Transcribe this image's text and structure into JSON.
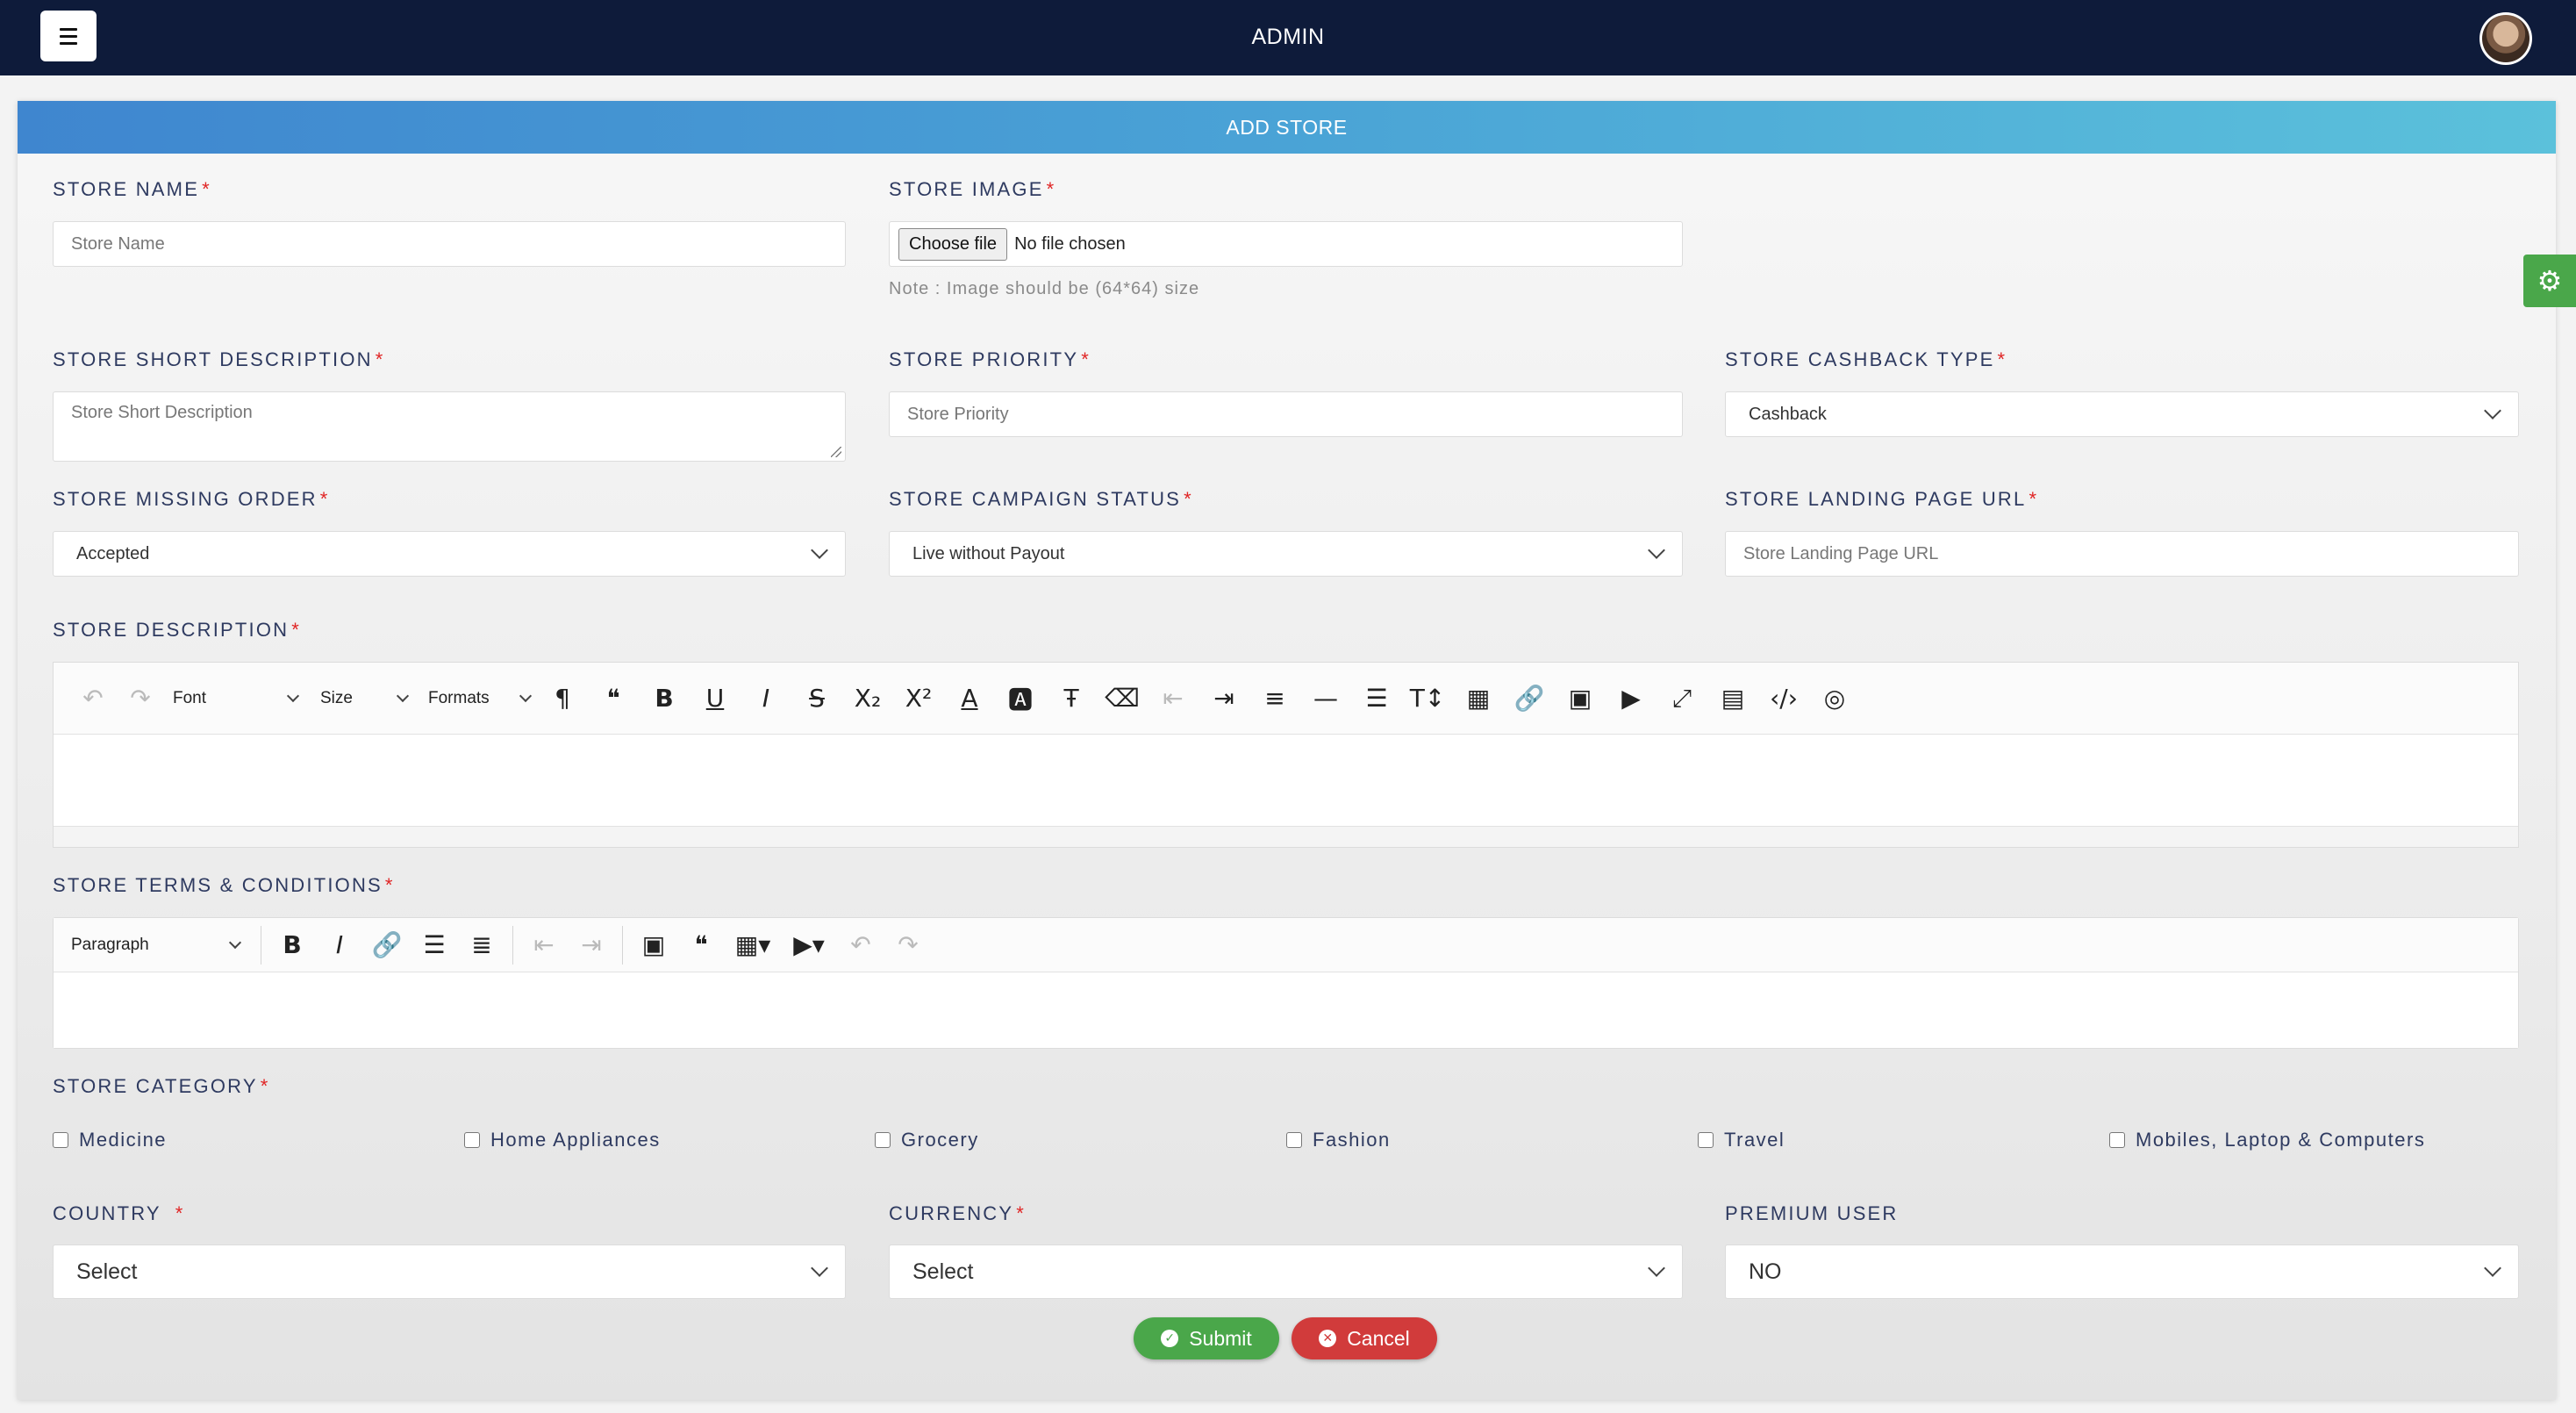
{
  "navbar": {
    "title": "ADMIN"
  },
  "card": {
    "title": "ADD STORE"
  },
  "fields": {
    "store_name": {
      "label": "STORE NAME",
      "placeholder": "Store Name"
    },
    "store_image": {
      "label": "STORE IMAGE",
      "button": "Choose file",
      "status": "No file chosen",
      "note": "Note : Image should be (64*64) size"
    },
    "short_desc": {
      "label": "STORE SHORT DESCRIPTION",
      "placeholder": "Store Short Description"
    },
    "priority": {
      "label": "STORE PRIORITY",
      "placeholder": "Store Priority"
    },
    "cashback_type": {
      "label": "STORE CASHBACK TYPE",
      "value": "Cashback"
    },
    "missing_order": {
      "label": "STORE MISSING ORDER",
      "value": "Accepted"
    },
    "campaign_status": {
      "label": "STORE CAMPAIGN STATUS",
      "value": "Live without Payout"
    },
    "landing_url": {
      "label": "STORE LANDING PAGE URL",
      "placeholder": "Store Landing Page URL"
    },
    "description": {
      "label": "STORE DESCRIPTION",
      "font": "Font",
      "size": "Size",
      "formats": "Formats"
    },
    "terms": {
      "label": "STORE TERMS & CONDITIONS",
      "block": "Paragraph"
    },
    "category": {
      "label": "STORE CATEGORY",
      "options": [
        "Medicine",
        "Home Appliances",
        "Grocery",
        "Fashion",
        "Travel",
        "Mobiles, Laptop & Computers"
      ]
    },
    "country": {
      "label": "COUNTRY",
      "value": "Select"
    },
    "currency": {
      "label": "CURRENCY",
      "value": "Select"
    },
    "premium": {
      "label": "PREMIUM USER",
      "value": "NO"
    }
  },
  "required_mark": "*",
  "actions": {
    "submit": "Submit",
    "cancel": "Cancel"
  },
  "colors": {
    "navbar": "#0e1b3a",
    "header_start": "#3f86cf",
    "header_end": "#5bc1db",
    "submit": "#4aa74a",
    "cancel": "#d13b3b",
    "required": "#e02424"
  }
}
